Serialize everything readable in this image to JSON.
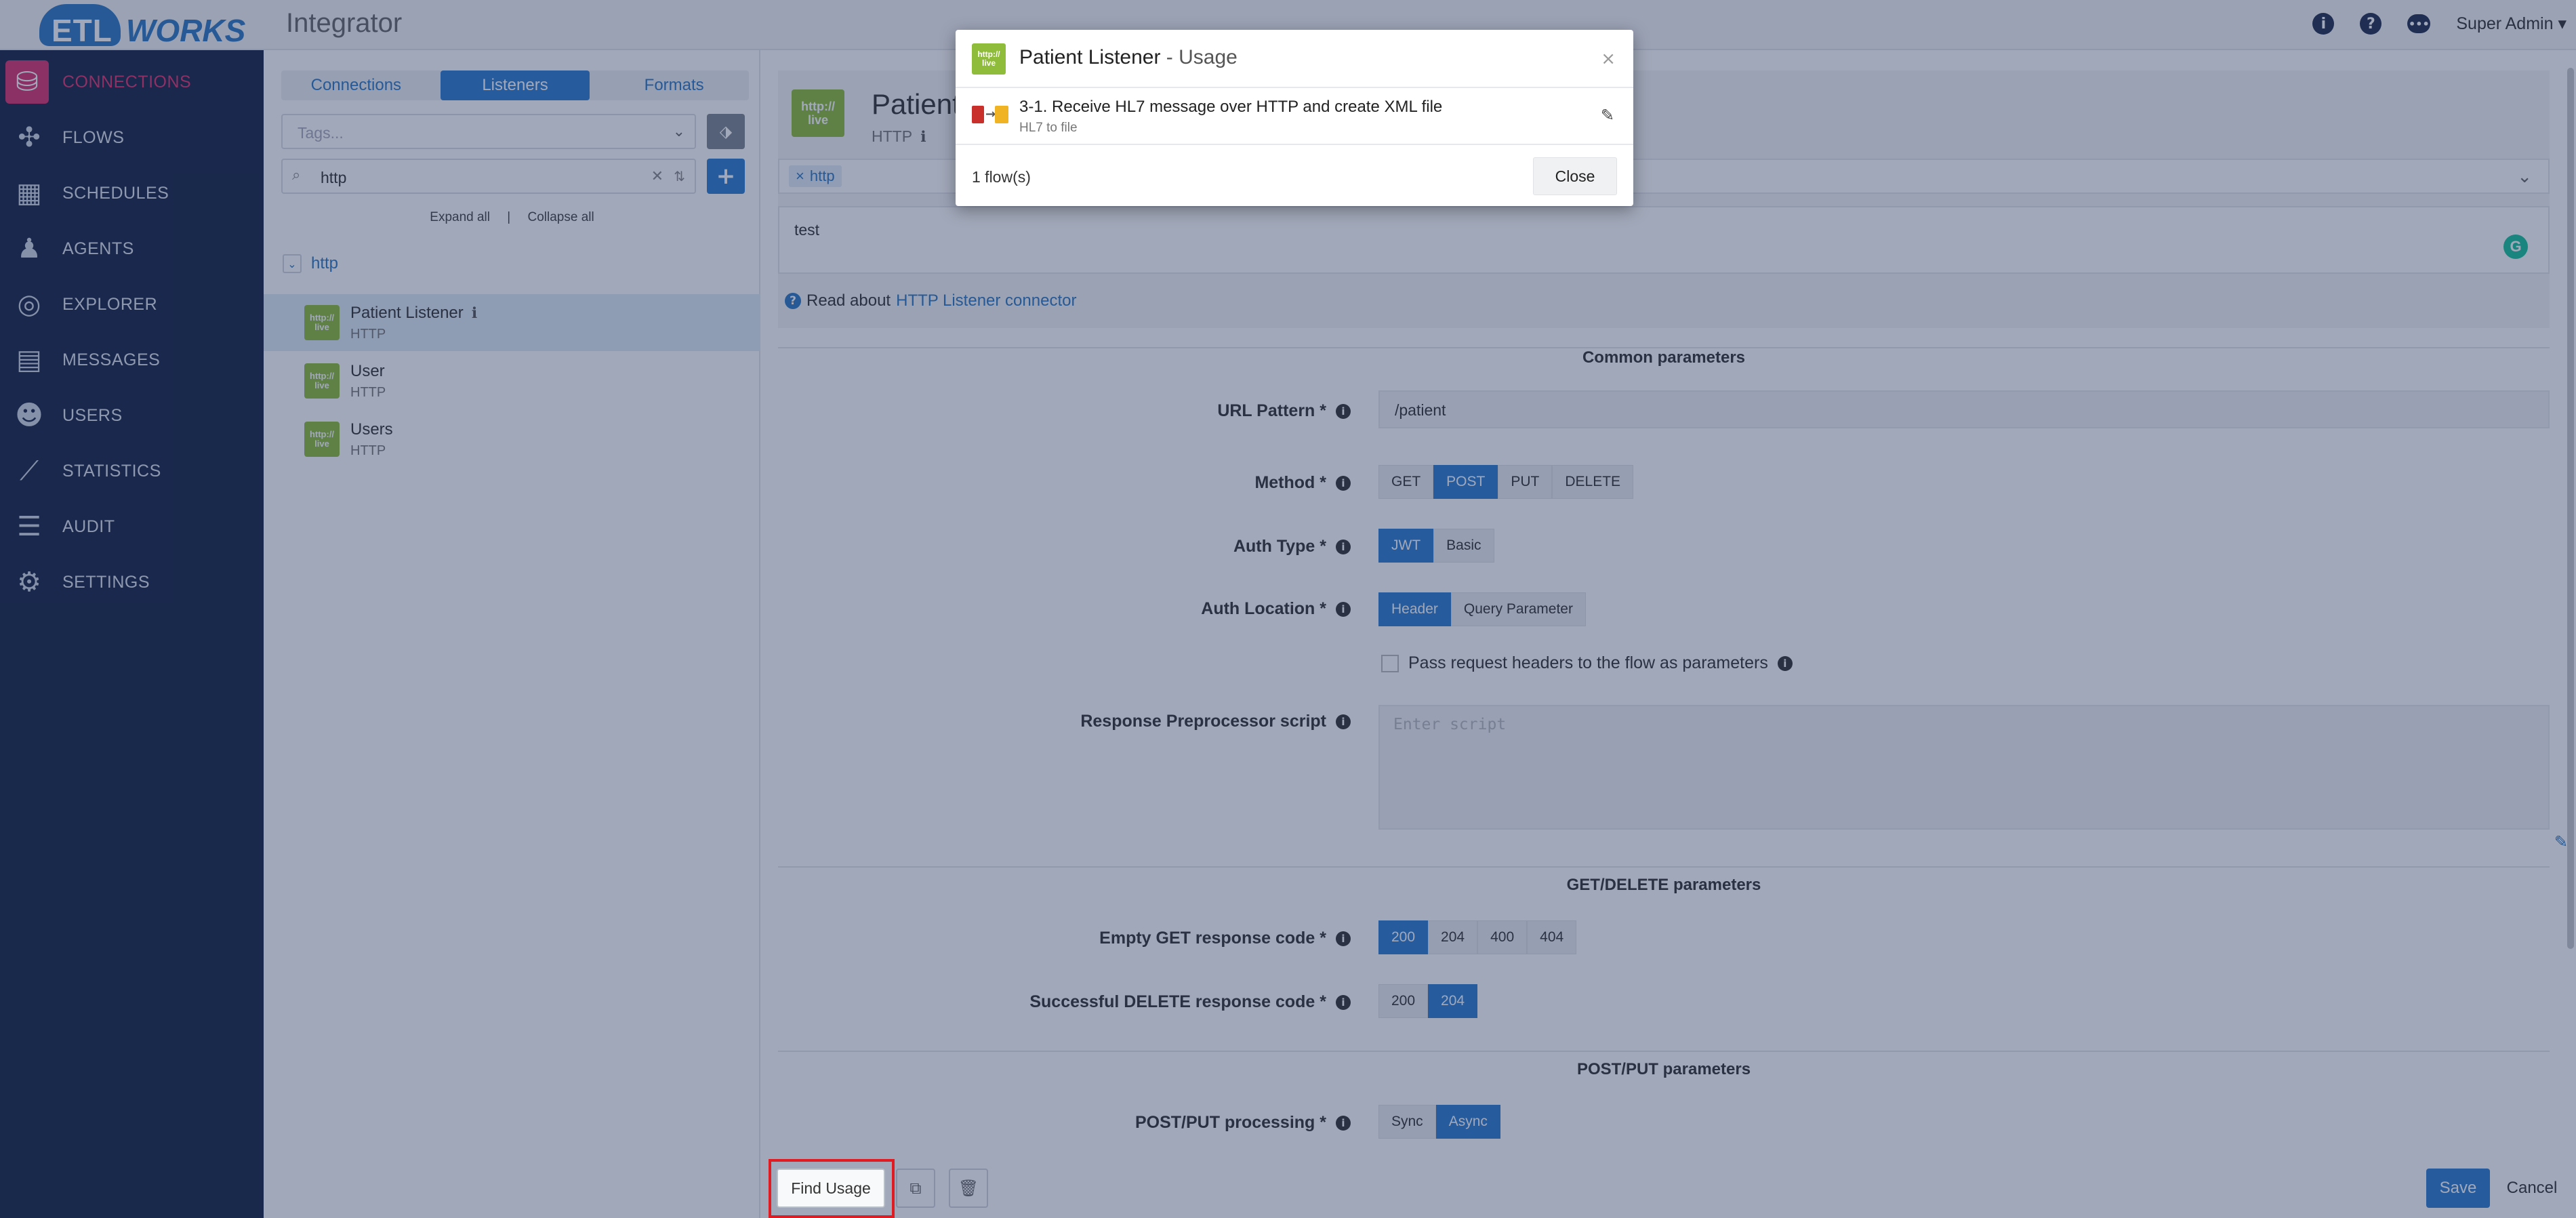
{
  "app": {
    "brand_etl": "ETL",
    "brand_works": "WORKS",
    "title": "Integrator",
    "user": "Super Admin"
  },
  "nav": {
    "items": [
      {
        "label": "CONNECTIONS",
        "icon": "database-icon",
        "active": true
      },
      {
        "label": "FLOWS",
        "icon": "puzzle-icon"
      },
      {
        "label": "SCHEDULES",
        "icon": "calendar-icon"
      },
      {
        "label": "AGENTS",
        "icon": "agent-icon"
      },
      {
        "label": "EXPLORER",
        "icon": "compass-icon"
      },
      {
        "label": "MESSAGES",
        "icon": "archive-icon"
      },
      {
        "label": "USERS",
        "icon": "users-icon"
      },
      {
        "label": "STATISTICS",
        "icon": "chart-line-icon"
      },
      {
        "label": "AUDIT",
        "icon": "list-icon"
      },
      {
        "label": "SETTINGS",
        "icon": "gears-icon"
      }
    ]
  },
  "left_panel": {
    "tabs": [
      "Connections",
      "Listeners",
      "Formats"
    ],
    "active_tab": "Listeners",
    "tags_placeholder": "Tags...",
    "search_value": "http",
    "expand_all": "Expand all",
    "separator": "|",
    "collapse_all": "Collapse all",
    "group_label": "http",
    "items": [
      {
        "name": "Patient Listener",
        "type": "HTTP",
        "selected": true
      },
      {
        "name": "User",
        "type": "HTTP"
      },
      {
        "name": "Users",
        "type": "HTTP"
      }
    ],
    "icon_text": "http://\nlive"
  },
  "editor": {
    "name": "Patient Listener",
    "type": "HTTP",
    "tag": "http",
    "description": "test",
    "read_about_prefix": "Read about",
    "read_about_link": "HTTP Listener connector",
    "sections": {
      "common": "Common parameters",
      "get_delete": "GET/DELETE parameters",
      "post_put": "POST/PUT parameters"
    },
    "url_pattern": {
      "label": "URL Pattern *",
      "value": "/patient"
    },
    "method": {
      "label": "Method *",
      "options": [
        "GET",
        "POST",
        "PUT",
        "DELETE"
      ],
      "selected": "POST"
    },
    "auth_type": {
      "label": "Auth Type *",
      "options": [
        "JWT",
        "Basic"
      ],
      "selected": "JWT"
    },
    "auth_location": {
      "label": "Auth Location *",
      "options": [
        "Header",
        "Query Parameter"
      ],
      "selected": "Header"
    },
    "pass_headers": {
      "label": "Pass request headers to the flow as parameters",
      "checked": false
    },
    "response_script": {
      "label": "Response Preprocessor script",
      "placeholder": "Enter script"
    },
    "empty_get": {
      "label": "Empty GET response code *",
      "options": [
        "200",
        "204",
        "400",
        "404"
      ],
      "selected": "200"
    },
    "successful_delete": {
      "label": "Successful DELETE response code *",
      "options": [
        "200",
        "204"
      ],
      "selected": "204"
    },
    "post_put_processing": {
      "label": "POST/PUT processing *",
      "options": [
        "Sync",
        "Async"
      ],
      "selected": "Async"
    }
  },
  "footer": {
    "find_usage": "Find Usage",
    "save": "Save",
    "cancel": "Cancel"
  },
  "modal": {
    "title_name": "Patient Listener",
    "title_suffix": " - Usage",
    "flow_name": "3-1. Receive HL7 message over HTTP and create XML file",
    "flow_desc": "HL7 to file",
    "count": "1 flow(s)",
    "close": "Close"
  },
  "colors": {
    "nav_bg": "#162444",
    "accent": "#2c7cd0",
    "active_nav": "#e0326e",
    "listener_icon": "#8fbc3a",
    "highlight": "#e01b22"
  }
}
